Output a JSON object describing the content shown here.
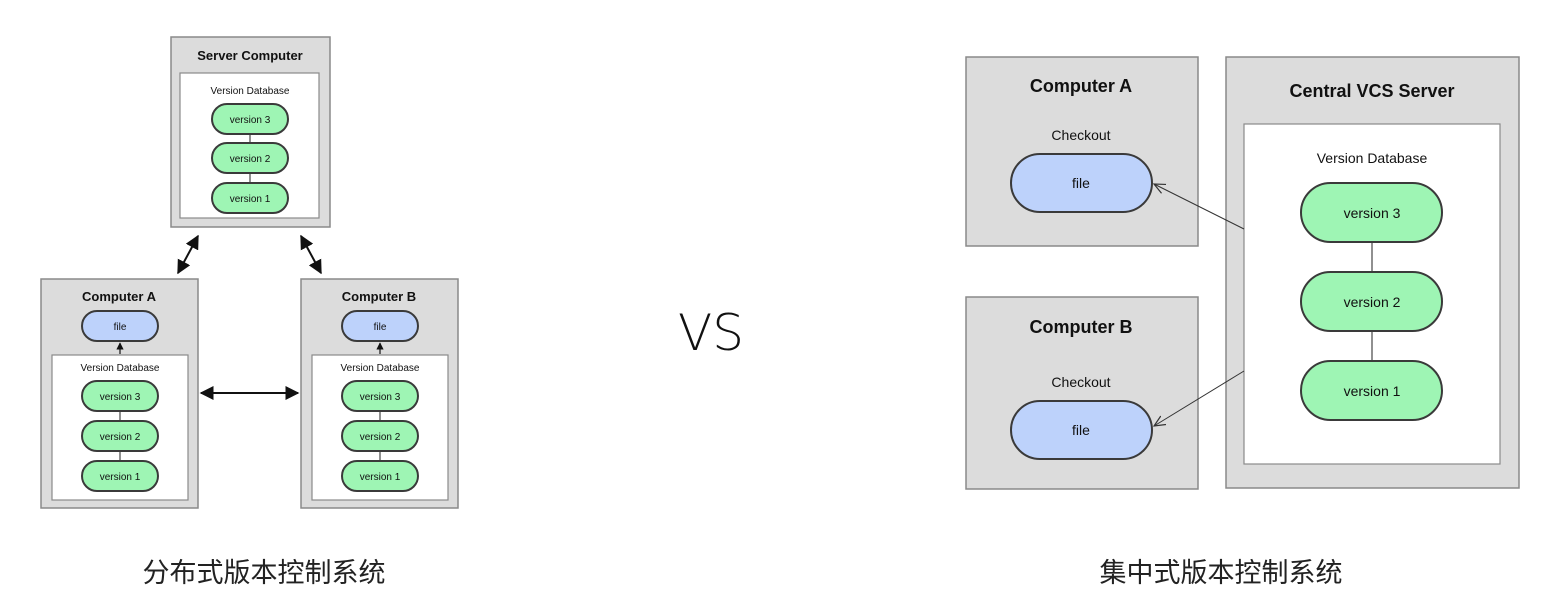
{
  "distributed": {
    "server": {
      "title": "Server Computer",
      "db_label": "Version Database",
      "versions": [
        "version 3",
        "version 2",
        "version 1"
      ]
    },
    "computer_a": {
      "title": "Computer A",
      "file_label": "file",
      "db_label": "Version Database",
      "versions": [
        "version 3",
        "version 2",
        "version 1"
      ]
    },
    "computer_b": {
      "title": "Computer B",
      "file_label": "file",
      "db_label": "Version Database",
      "versions": [
        "version 3",
        "version 2",
        "version 1"
      ]
    },
    "caption": "分布式版本控制系统"
  },
  "vs_label": "VS",
  "centralized": {
    "computer_a": {
      "title": "Computer A",
      "checkout_label": "Checkout",
      "file_label": "file"
    },
    "computer_b": {
      "title": "Computer B",
      "checkout_label": "Checkout",
      "file_label": "file"
    },
    "server": {
      "title": "Central VCS Server",
      "db_label": "Version Database",
      "versions": [
        "version 3",
        "version 2",
        "version 1"
      ]
    },
    "caption": "集中式版本控制系统"
  },
  "colors": {
    "version_fill": "#9ef5b4",
    "file_fill": "#bdd2fb",
    "box_fill": "#dcdcdc"
  }
}
